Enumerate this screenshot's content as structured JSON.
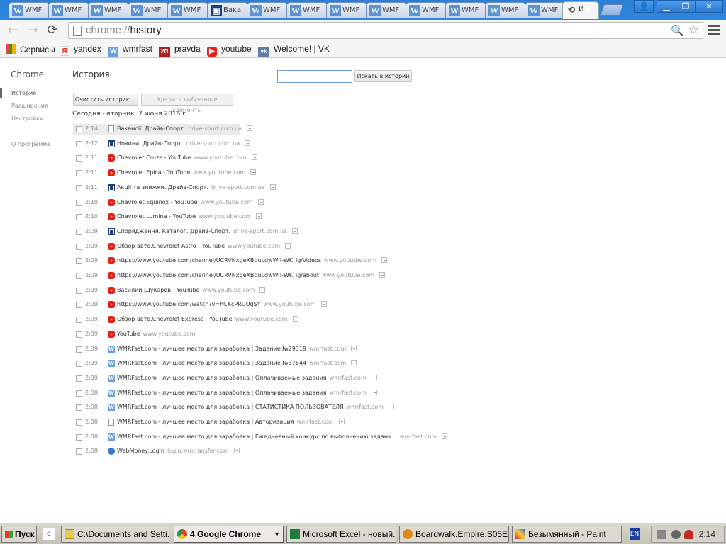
{
  "tabs": {
    "wm_label": "WMF",
    "wm_icon_letter": "W",
    "drive_label": "Вака",
    "active_label": "И",
    "close": "✕"
  },
  "window": {
    "minimize": "▁",
    "restore": "❐",
    "close": "✕",
    "user": "👤"
  },
  "toolbar": {
    "back": "←",
    "forward": "→",
    "reload": "⟳",
    "url_scheme": "chrome://",
    "url_path": "history",
    "zoom": "🔍",
    "star": "☆"
  },
  "bookmarks": [
    {
      "label": "Сервисы",
      "icon": "apps-grid-icon",
      "color": "#e04a3f"
    },
    {
      "label": "yandex",
      "icon": "yandex-icon",
      "color": "#fff"
    },
    {
      "label": "wmrfast",
      "icon": "wmrfast-icon",
      "color": "#6aa0e0"
    },
    {
      "label": "pravda",
      "icon": "pravda-icon",
      "color": "#a82020"
    },
    {
      "label": "youtube",
      "icon": "youtube-icon",
      "color": "#e62117"
    },
    {
      "label": "Welcome! | VK",
      "icon": "vk-icon",
      "color": "#5b7da6"
    }
  ],
  "bookmark_icon_text": {
    "yandex": "Я",
    "wmrfast": "W",
    "pravda": "УП",
    "vk": "vk"
  },
  "sidebar": {
    "title": "Chrome",
    "items": [
      "История",
      "Расширения",
      "Настройки"
    ],
    "about": "О программе"
  },
  "main": {
    "title": "История",
    "search_button": "Искать в истории",
    "clear_button": "Очистить историю...",
    "delete_button": "Удалить выбранные элементы",
    "day_header": "Сегодня - вторник, 7 июня 2016 г."
  },
  "history": [
    {
      "time": "2:14",
      "title": "Вакансії. Драйв-Спорт.",
      "domain": "drive-sport.com.ua",
      "fav": "doc"
    },
    {
      "time": "2:12",
      "title": "Новини. Драйв-Спорт.",
      "domain": "drive-sport.com.ua",
      "fav": "ds"
    },
    {
      "time": "2:11",
      "title": "Chevrolet Cruze - YouTube",
      "domain": "www.youtube.com",
      "fav": "yt"
    },
    {
      "time": "2:11",
      "title": "Chevrolet Epica - YouTube",
      "domain": "www.youtube.com",
      "fav": "yt"
    },
    {
      "time": "2:11",
      "title": "Акції та знижки. Драйв-Спорт.",
      "domain": "drive-sport.com.ua",
      "fav": "ds"
    },
    {
      "time": "2:10",
      "title": "Chevrolet Equinox - YouTube",
      "domain": "www.youtube.com",
      "fav": "yt"
    },
    {
      "time": "2:10",
      "title": "Chevrolet Lumina - YouTube",
      "domain": "www.youtube.com",
      "fav": "yt"
    },
    {
      "time": "2:09",
      "title": "Спорядження. Каталог. Драйв-Спорт.",
      "domain": "drive-sport.com.ua",
      "fav": "ds"
    },
    {
      "time": "2:09",
      "title": "Обзор авто.Chevrolet Astro - YouTube",
      "domain": "www.youtube.com",
      "fav": "yt"
    },
    {
      "time": "2:09",
      "title": "https://www.youtube.com/channel/UCRVNxgeXBquLdwWII-WK_ig/videos",
      "domain": "www.youtube.com",
      "fav": "yt"
    },
    {
      "time": "2:09",
      "title": "https://www.youtube.com/channel/UCRVNxgeXBquLdwWII-WK_ig/about",
      "domain": "www.youtube.com",
      "fav": "yt"
    },
    {
      "time": "2:09",
      "title": "Василий Щукарев - YouTube",
      "domain": "www.youtube.com",
      "fav": "yt"
    },
    {
      "time": "2:09",
      "title": "https://www.youtube.com/watch?v=hCKcPRUUqSY",
      "domain": "www.youtube.com",
      "fav": "yt"
    },
    {
      "time": "2:09",
      "title": "Обзор авто.Chevrolet Express - YouTube",
      "domain": "www.youtube.com",
      "fav": "yt"
    },
    {
      "time": "2:09",
      "title": "YouTube",
      "domain": "www.youtube.com",
      "fav": "yt"
    },
    {
      "time": "2:09",
      "title": "WMRFast.com - лучшее место для заработка | Задание №29319",
      "domain": "wmrfast.com",
      "fav": "wm"
    },
    {
      "time": "2:09",
      "title": "WMRFast.com - лучшее место для заработка | Задание №37644",
      "domain": "wmrfast.com",
      "fav": "wm"
    },
    {
      "time": "2:09",
      "title": "WMRFast.com - лучшее место для заработка | Оплачиваемые задания",
      "domain": "wmrfast.com",
      "fav": "wm"
    },
    {
      "time": "2:08",
      "title": "WMRFast.com - лучшее место для заработка | Оплачиваемые задания",
      "domain": "wmrfast.com",
      "fav": "wm"
    },
    {
      "time": "2:08",
      "title": "WMRFast.com - лучшее место для заработка | СТАТИСТИКА ПОЛЬЗОВАТЕЛЯ",
      "domain": "wmrfast.com",
      "fav": "wm"
    },
    {
      "time": "2:08",
      "title": "WMRFast.com - лучшее место для заработка | Авторизация",
      "domain": "wmrfast.com",
      "fav": "doc"
    },
    {
      "time": "2:08",
      "title": "WMRFast.com - лучшее место для заработка | Ежедневный конкурс по выполнению задани...",
      "domain": "wmrfast.com",
      "fav": "wm"
    },
    {
      "time": "2:08",
      "title": "WebMoney.Login",
      "domain": "login.wmtransfer.com",
      "fav": "wmt"
    }
  ],
  "taskbar": {
    "start": "Пуск",
    "tasks": [
      "C:\\Documents and Setti...",
      "4 Google Chrome",
      "Microsoft Excel - новый...",
      "Boardwalk.Empire.S05E...",
      "Безымянный - Paint"
    ],
    "lang": "EN",
    "clock": "2:14"
  }
}
